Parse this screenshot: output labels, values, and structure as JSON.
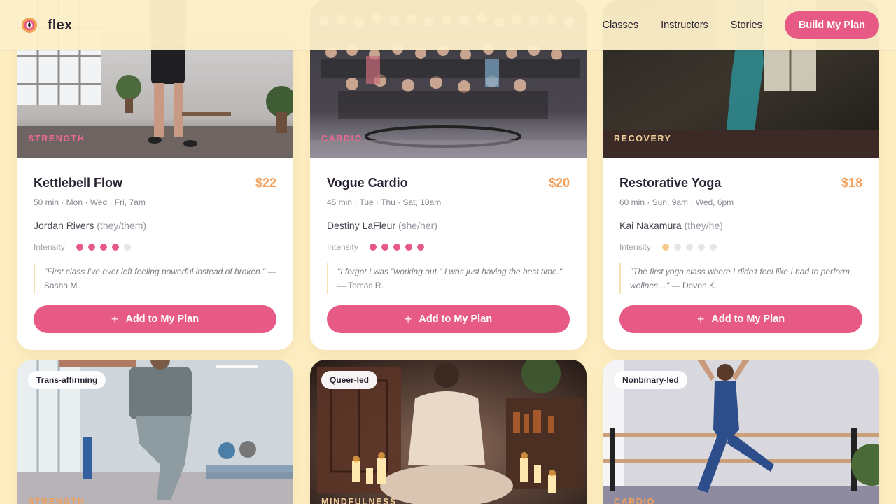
{
  "nav": {
    "brand": "flex",
    "links": [
      "Classes",
      "Instructors",
      "Stories"
    ],
    "cta": "Build My Plan"
  },
  "classes": [
    {
      "category": "Strength",
      "title": "Kettlebell Flow",
      "price": "$22",
      "schedule": "50 min · Mon · Wed · Fri, 7am",
      "instructor": "Jordan Rivers",
      "pronouns": "(they/them)",
      "intensity_label": "Intensity",
      "intensity": 4,
      "quote": "\"First class I've ever left feeling powerful instead of broken.\"",
      "quote_author": "— Sasha M.",
      "button": "Add to My Plan"
    },
    {
      "category": "Cardio",
      "title": "Vogue Cardio",
      "price": "$20",
      "schedule": "45 min · Tue · Thu · Sat, 10am",
      "instructor": "Destiny LaFleur",
      "pronouns": "(she/her)",
      "intensity_label": "Intensity",
      "intensity": 5,
      "quote": "\"I forgot I was \"working out.\" I was just having the best time.\"",
      "quote_author": "— Tomás R.",
      "button": "Add to My Plan"
    },
    {
      "category": "Recovery",
      "title": "Restorative Yoga",
      "price": "$18",
      "schedule": "60 min · Sun, 9am · Wed, 6pm",
      "instructor": "Kai Nakamura",
      "pronouns": "(they/he)",
      "intensity_label": "Intensity",
      "intensity": 1,
      "quote": "\"The first yoga class where I didn't feel like I had to perform wellnes…\"",
      "quote_author": "— Devon K.",
      "button": "Add to My Plan"
    },
    {
      "category": "Strength",
      "badge": "Trans-affirming"
    },
    {
      "category": "Mindfulness",
      "badge": "Queer-led"
    },
    {
      "category": "Cardio",
      "badge": "Nonbinary-led"
    }
  ],
  "colors": {
    "accent": "#e65a85",
    "price": "#f0a05a",
    "background": "#fdeec2"
  }
}
